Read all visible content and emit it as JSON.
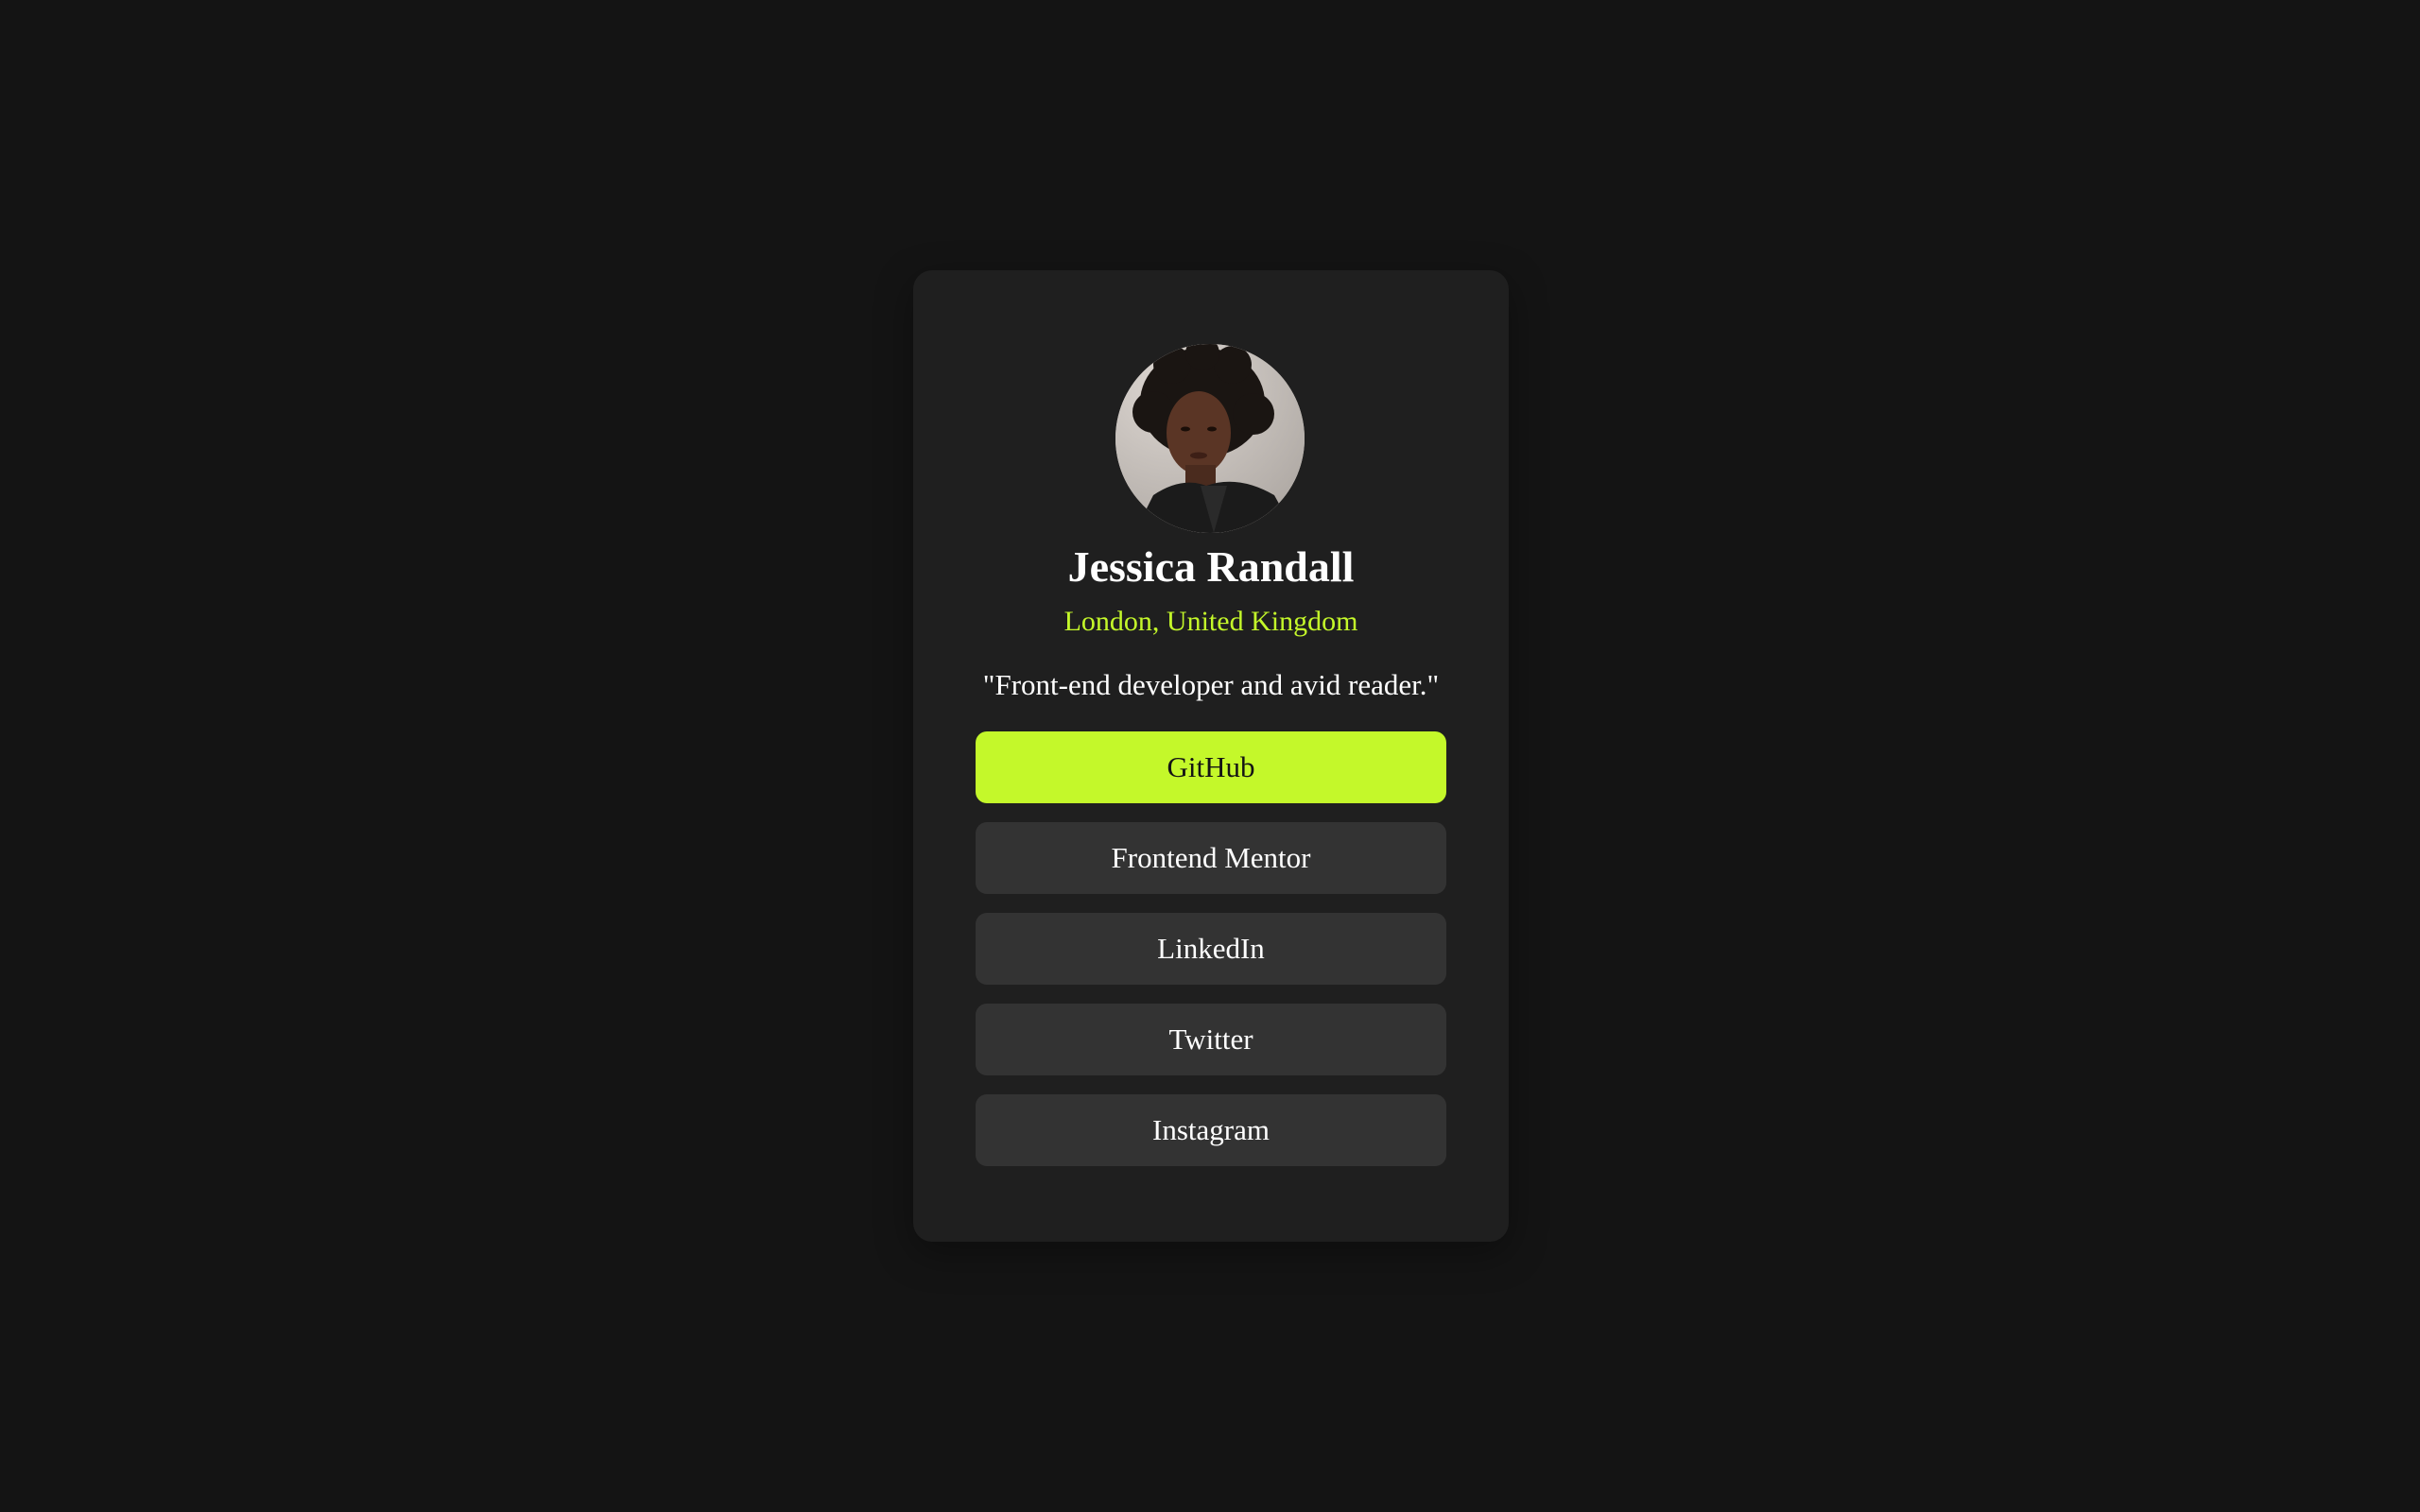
{
  "profile": {
    "name": "Jessica Randall",
    "location": "London, United Kingdom",
    "bio": "\"Front-end developer and avid reader.\""
  },
  "links": [
    {
      "label": "GitHub",
      "active": true
    },
    {
      "label": "Frontend Mentor",
      "active": false
    },
    {
      "label": "LinkedIn",
      "active": false
    },
    {
      "label": "Twitter",
      "active": false
    },
    {
      "label": "Instagram",
      "active": false
    }
  ],
  "colors": {
    "background": "#141414",
    "card": "#1f1f1f",
    "button": "#333333",
    "accent": "#c4f82a",
    "text": "#ffffff"
  }
}
